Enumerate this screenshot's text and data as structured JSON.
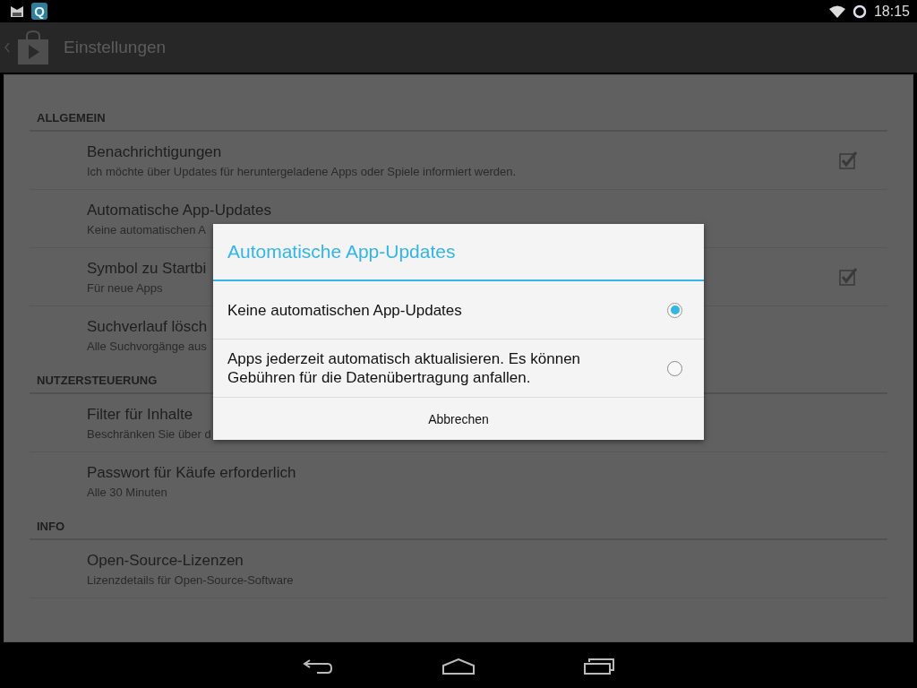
{
  "status_bar": {
    "app_badge": "Q",
    "time": "18:15"
  },
  "action_bar": {
    "title": "Einstellungen"
  },
  "sections": [
    {
      "header": "ALLGEMEIN",
      "items": [
        {
          "kind": "checkbox",
          "title": "Benachrichtigungen",
          "subtitle": "Ich möchte über Updates für heruntergeladene Apps oder Spiele informiert werden.",
          "checked": true
        },
        {
          "kind": "plain",
          "title": "Automatische App-Updates",
          "subtitle": "Keine automatischen A"
        },
        {
          "kind": "checkbox",
          "title": "Symbol zu Startbi",
          "subtitle": "Für neue Apps",
          "checked": true
        },
        {
          "kind": "plain",
          "title": "Suchverlauf lösch",
          "subtitle": "Alle Suchvorgänge aus"
        }
      ]
    },
    {
      "header": "NUTZERSTEUERUNG",
      "items": [
        {
          "kind": "plain",
          "title": "Filter für Inhalte",
          "subtitle": "Beschränken Sie über d"
        },
        {
          "kind": "plain",
          "title": "Passwort für Käufe erforderlich",
          "subtitle": "Alle 30 Minuten"
        }
      ]
    },
    {
      "header": "INFO",
      "items": [
        {
          "kind": "plain",
          "title": "Open-Source-Lizenzen",
          "subtitle": "Lizenzdetails für Open-Source-Software"
        }
      ]
    }
  ],
  "dialog": {
    "title": "Automatische App-Updates",
    "options": [
      {
        "label": "Keine automatischen App-Updates",
        "selected": true
      },
      {
        "label": "Apps jederzeit automatisch aktualisieren. Es können Gebühren für die Datenübertragung anfallen.",
        "selected": false
      }
    ],
    "cancel": "Abbrechen"
  }
}
